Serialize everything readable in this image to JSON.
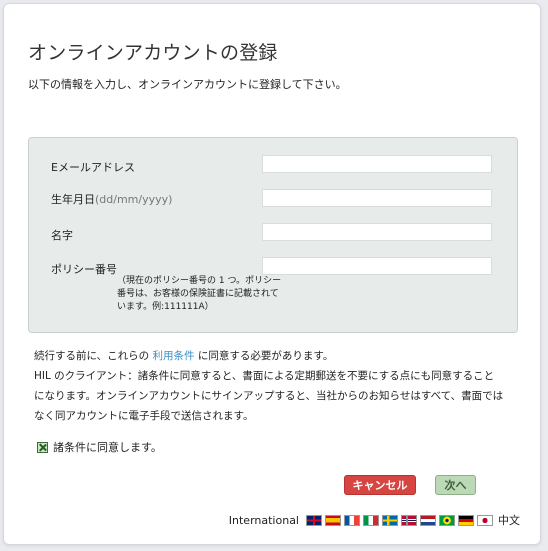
{
  "page": {
    "title": "オンラインアカウントの登録",
    "subtitle": "以下の情報を入力し、オンラインアカウントに登録して下さい。"
  },
  "form": {
    "email_label": "Eメールアドレス",
    "email_value": "",
    "dob_label": "生年月日",
    "dob_hint": "(dd/mm/yyyy)",
    "dob_value": "",
    "name_label": "名字",
    "name_value": "",
    "policy_label": "ポリシー番号",
    "policy_value": "",
    "policy_note": "（現在のポリシー番号の 1 つ。ポリシー番号は、お客様の保険証書に記載されています。例:111111A）"
  },
  "terms": {
    "line1_prefix": "続行する前に、これらの",
    "line1_link": "利用条件",
    "line1_suffix": "に同意する必要があります。",
    "line2": "HIL のクライアント：諸条件に同意すると、書面による定期郵送を不要にする点にも同意することになります。オンラインアカウントにサインアップすると、当社からのお知らせはすべて、書面ではなく同アカウントに電子手段で送信されます。"
  },
  "agree": {
    "label": "諸条件に同意します。",
    "checked": true
  },
  "buttons": {
    "cancel_label": "キャンセル",
    "next_label": "次へ"
  },
  "footer": {
    "international_label": "International",
    "flags": [
      "uk-flag-icon",
      "spain-flag-icon",
      "france-flag-icon",
      "italy-flag-icon",
      "sweden-flag-icon",
      "norway-flag-icon",
      "netherlands-flag-icon",
      "brazil-flag-icon",
      "germany-flag-icon",
      "japan-flag-icon"
    ],
    "chinese_label": "中文"
  },
  "colors": {
    "cancel": "#d64541",
    "next": "#bcd8b6",
    "link": "#3b8ec4",
    "panel": "#e7eceb"
  }
}
